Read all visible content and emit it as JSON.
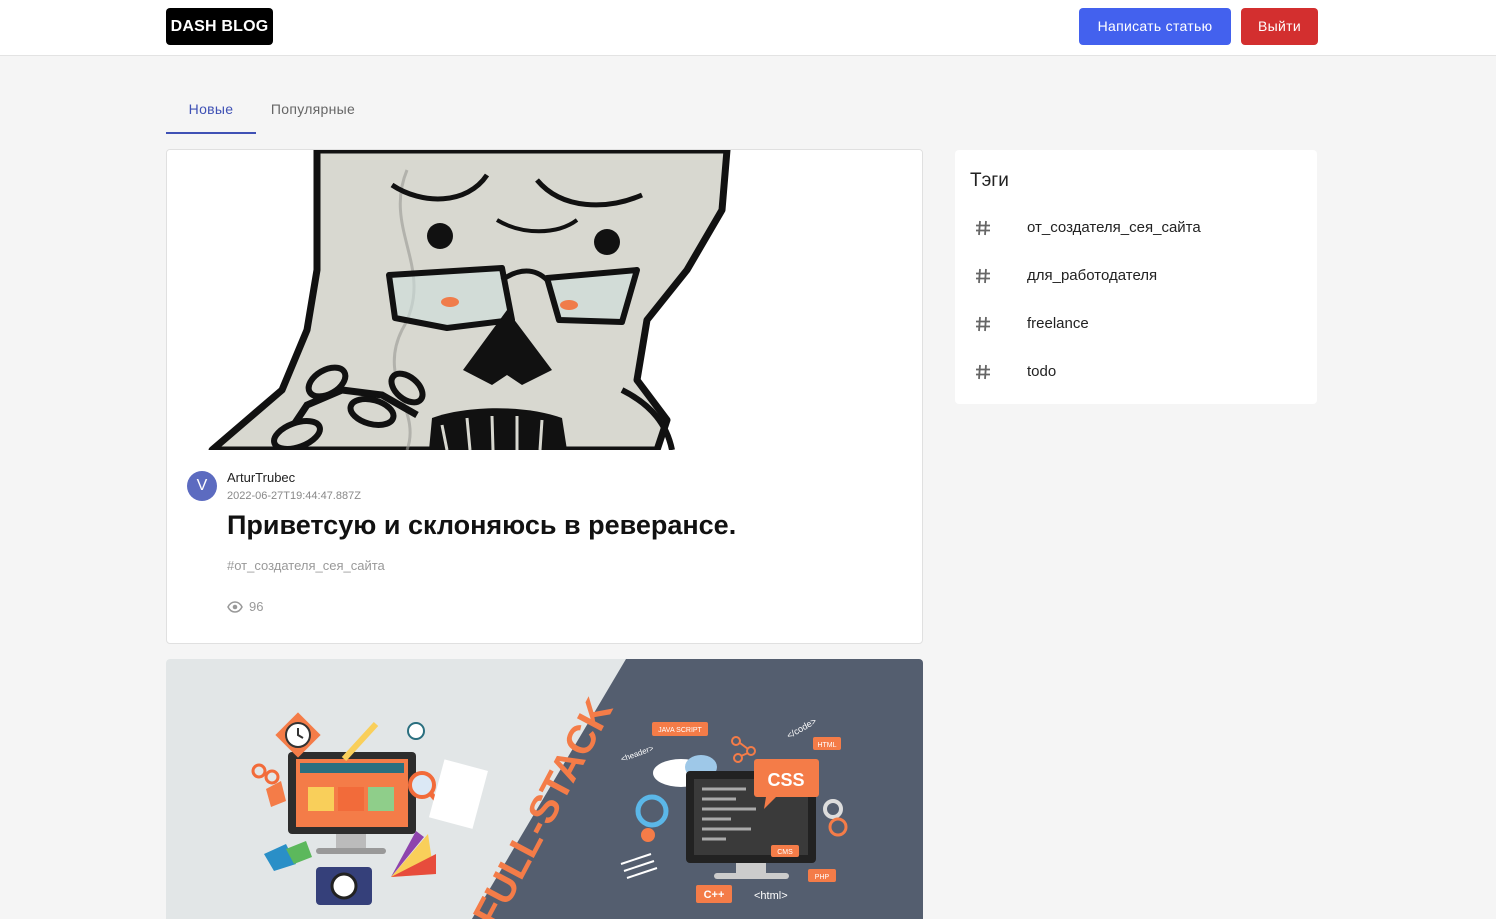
{
  "header": {
    "logo": "DASH BLOG",
    "write_label": "Написать статью",
    "logout_label": "Выйти"
  },
  "tabs": [
    {
      "label": "Новые",
      "active": true
    },
    {
      "label": "Популярные",
      "active": false
    }
  ],
  "posts": [
    {
      "avatar_letter": "V",
      "author": "ArturTrubec",
      "date": "2022-06-27T19:44:47.887Z",
      "title": "Приветсую и склоняюсь в реверансе.",
      "tag": "#от_создателя_сея_сайта",
      "views": "96"
    }
  ],
  "banner": {
    "word": "FULL-STACK",
    "labels": [
      "JAVA SCRIPT",
      "</code>",
      "HTML",
      "<header>",
      "CSS",
      "CMS",
      "PHP",
      "C++",
      "<html>"
    ]
  },
  "sidebar": {
    "title": "Тэги",
    "tags": [
      "от_создателя_сея_сайта",
      "для_работодателя",
      "freelance",
      "todo"
    ]
  },
  "colors": {
    "primary": "#4361ee",
    "danger": "#d32f2f",
    "tab_active": "#3f51b5",
    "avatar": "#5c6bc0",
    "banner_dark": "#545e6f",
    "banner_light": "#e2e6e7",
    "banner_accent": "#f47c48"
  }
}
